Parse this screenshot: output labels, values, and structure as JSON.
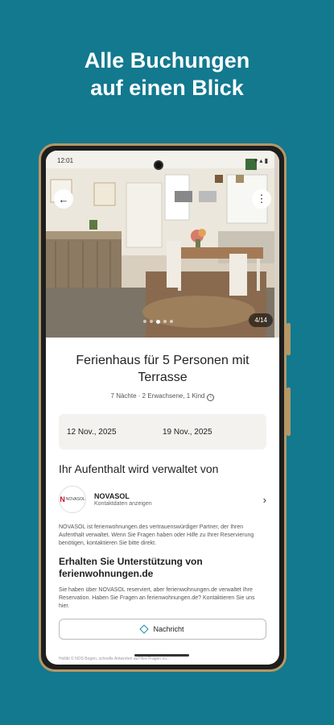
{
  "headline": {
    "line1": "Alle Buchungen",
    "line2": "auf einen Blick"
  },
  "status": {
    "time": "12:01",
    "icons": "▾ ▴ ▮"
  },
  "gallery": {
    "counter": "4/14",
    "dots": 5,
    "active_dot": 2
  },
  "listing": {
    "title": "Ferienhaus für 5 Personen mit Terrasse",
    "meta": "7 Nächte · 2 Erwachsene, 1 Kind",
    "checkin": "12 Nov., 2025",
    "checkout": "19 Nov., 2025"
  },
  "managed": {
    "heading": "Ihr Aufenthalt wird verwaltet von",
    "logo_text": "NOVASOL",
    "name": "NOVASOL",
    "sub": "Kontaktdaten anzeigen",
    "description": "NOVASOL ist ferienwohnungen.des vertrauenswürdiger Partner, der Ihren Aufenthalt verwaltet. Wenn Sie Fragen haben oder Hilfe zu Ihrer Reservierung benötigen, kontaktieren Sie bitte direkt."
  },
  "support": {
    "heading": "Erhalten Sie Unterstützung von ferienwohnungen.de",
    "text": "Sie haben über NOVASOL reserviert, aber ferienwohnungen.de verwaltet Ihre Reservation. Haben Sie Fragen an ferienwohnungen.de? Kontaktieren Sie uns hier.",
    "button": "Nachricht"
  },
  "footer_cut": "Hollibi © NOS Bogen, schnelle Antworten auf Ihre Fragen zu..."
}
